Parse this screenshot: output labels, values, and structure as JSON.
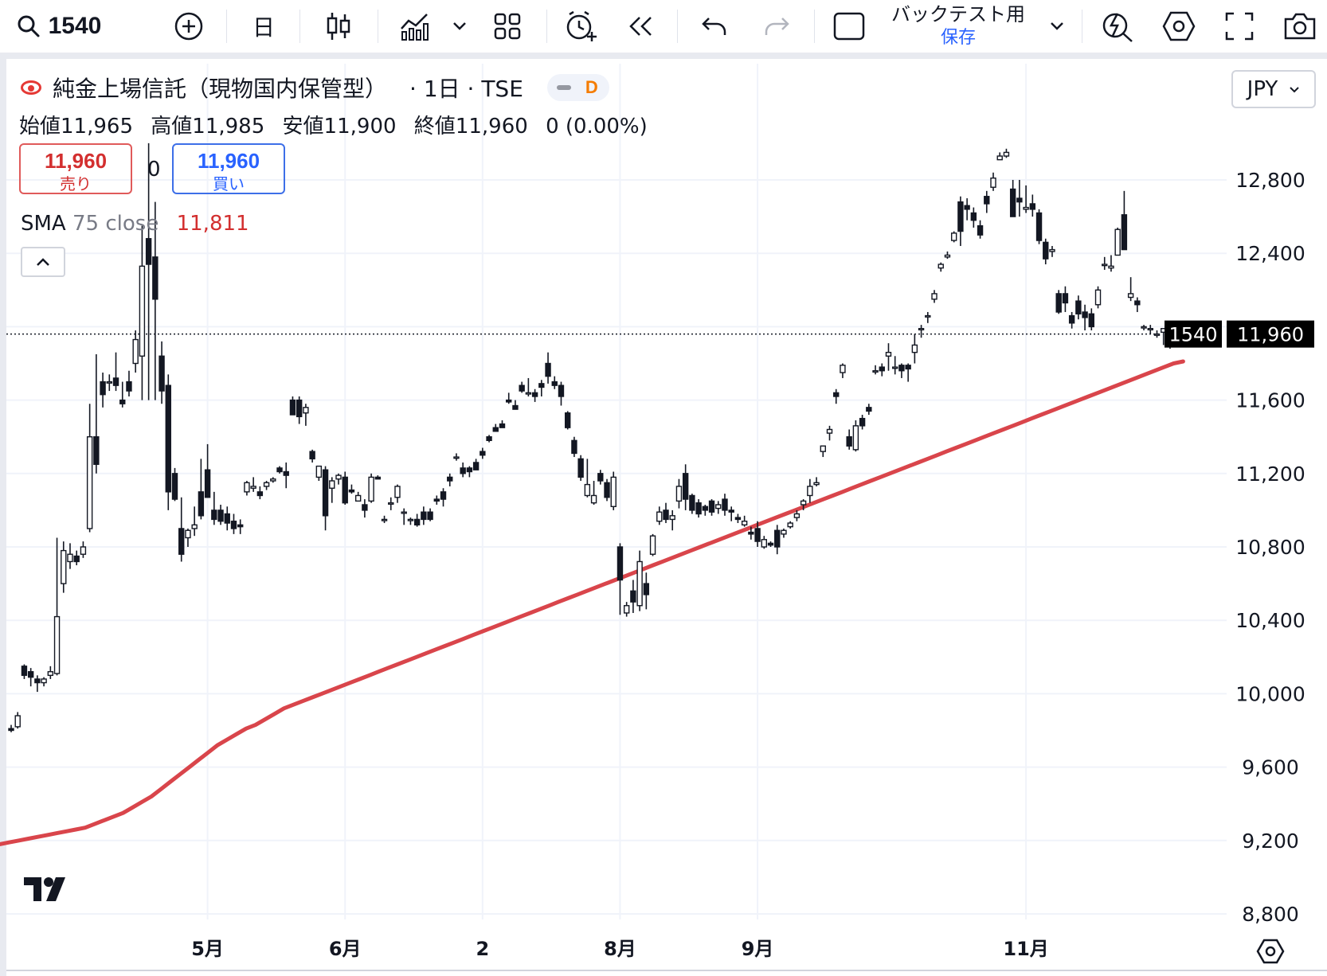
{
  "toolbar": {
    "symbol": "1540",
    "interval": "日",
    "backtest_line1": "バックテスト用",
    "backtest_line2": "保存"
  },
  "legend": {
    "title": "純金上場信託（現物国内保管型）",
    "interval_exchange": "· 1日 · TSE",
    "data_badge": "D",
    "ohlc": [
      {
        "label": "始値",
        "value": "11,965"
      },
      {
        "label": "高値",
        "value": "11,985"
      },
      {
        "label": "安値",
        "value": "11,900"
      },
      {
        "label": "終値",
        "value": "11,960"
      },
      {
        "label": "",
        "value": "0 (0.00%)"
      }
    ],
    "sell_price": "11,960",
    "sell_label": "売り",
    "spread": "0",
    "buy_price": "11,960",
    "buy_label": "買い",
    "sma_name": "SMA",
    "sma_params": "75 close",
    "sma_value": "11,811",
    "collapse_glyph": "^"
  },
  "currency": "JPY",
  "price_tags": {
    "symbol": "1540",
    "price": "11,960"
  },
  "colors": {
    "sma": "#d9454b",
    "candle": "#131722",
    "grid": "#f0f3fa",
    "sell": "#d32f2f",
    "buy": "#2962ff"
  },
  "icons": [
    "search-icon",
    "add-symbol-icon",
    "bar-style-icon",
    "indicators-icon",
    "layout-icon",
    "alert-icon",
    "replay-icon",
    "undo-icon",
    "redo-icon",
    "checkbox-icon",
    "chevron-down-icon",
    "lightning-search-icon",
    "settings-icon",
    "fullscreen-icon",
    "camera-icon",
    "chart-settings-icon"
  ],
  "chart_data": {
    "type": "candlestick",
    "symbol": "1540",
    "price_scale_ticks": [
      12800,
      12400,
      12000,
      11600,
      11200,
      10800,
      10400,
      10000,
      9600,
      9200,
      8800
    ],
    "price_scale_labels": [
      "12,800",
      "12,400",
      "",
      "11,600",
      "11,200",
      "10,800",
      "10,400",
      "10,000",
      "9,600",
      "9,200",
      "8,800"
    ],
    "ylim": [
      8800,
      13100
    ],
    "time_axis_labels": [
      {
        "label": "5月",
        "bar": 30
      },
      {
        "label": "6月",
        "bar": 51
      },
      {
        "label": "2",
        "bar": 72
      },
      {
        "label": "8月",
        "bar": 93
      },
      {
        "label": "9月",
        "bar": 114
      },
      {
        "label": "11月",
        "bar": 155
      }
    ],
    "last_price": 11960,
    "candles": [
      [
        9810,
        9830,
        9790,
        9800
      ],
      [
        9820,
        9900,
        9810,
        9880
      ],
      [
        10150,
        10160,
        10080,
        10100
      ],
      [
        10120,
        10140,
        10040,
        10090
      ],
      [
        10080,
        10100,
        10010,
        10060
      ],
      [
        10060,
        10090,
        10040,
        10080
      ],
      [
        10100,
        10150,
        10080,
        10120
      ],
      [
        10110,
        10850,
        10100,
        10420
      ],
      [
        10600,
        10830,
        10550,
        10780
      ],
      [
        10720,
        10820,
        10680,
        10760
      ],
      [
        10750,
        10780,
        10700,
        10720
      ],
      [
        10760,
        10830,
        10740,
        10800
      ],
      [
        10900,
        11580,
        10880,
        11400
      ],
      [
        11400,
        11850,
        11200,
        11250
      ],
      [
        11700,
        11750,
        11560,
        11630
      ],
      [
        11700,
        11740,
        11650,
        11700
      ],
      [
        11720,
        11860,
        11650,
        11680
      ],
      [
        11600,
        11700,
        11560,
        11580
      ],
      [
        11700,
        11760,
        11620,
        11650
      ],
      [
        11800,
        11980,
        11750,
        11930
      ],
      [
        11840,
        12550,
        11600,
        12330
      ],
      [
        12480,
        13000,
        11600,
        12340
      ],
      [
        12380,
        12680,
        11600,
        12150
      ],
      [
        11840,
        11920,
        11580,
        11650
      ],
      [
        11680,
        11740,
        11000,
        11100
      ],
      [
        11200,
        11230,
        11050,
        11060
      ],
      [
        10900,
        11070,
        10720,
        10760
      ],
      [
        10850,
        10900,
        10800,
        10890
      ],
      [
        10900,
        11020,
        10860,
        10920
      ],
      [
        11100,
        11280,
        10950,
        10970
      ],
      [
        11220,
        11360,
        11100,
        11070
      ],
      [
        11000,
        11100,
        10920,
        10950
      ],
      [
        11000,
        11030,
        10920,
        10940
      ],
      [
        10980,
        11020,
        10890,
        10930
      ],
      [
        10940,
        10980,
        10870,
        10900
      ],
      [
        10920,
        10950,
        10870,
        10910
      ],
      [
        11100,
        11160,
        11080,
        11150
      ],
      [
        11120,
        11180,
        11100,
        11130
      ],
      [
        11100,
        11130,
        11060,
        11080
      ],
      [
        11130,
        11160,
        11110,
        11150
      ],
      [
        11160,
        11180,
        11150,
        11170
      ],
      [
        11230,
        11240,
        11200,
        11210
      ],
      [
        11210,
        11260,
        11120,
        11190
      ],
      [
        11600,
        11620,
        11580,
        11520
      ],
      [
        11600,
        11620,
        11470,
        11510
      ],
      [
        11530,
        11580,
        11460,
        11560
      ],
      [
        11320,
        11330,
        11260,
        11280
      ],
      [
        11180,
        11240,
        11160,
        11240
      ],
      [
        11220,
        11240,
        10890,
        10970
      ],
      [
        11120,
        11180,
        11040,
        11160
      ],
      [
        11170,
        11200,
        11140,
        11190
      ],
      [
        11180,
        11210,
        11030,
        11040
      ],
      [
        11110,
        11140,
        11090,
        11100
      ],
      [
        11050,
        11100,
        11070,
        11080
      ],
      [
        11030,
        11060,
        10960,
        11000
      ],
      [
        11050,
        11200,
        11040,
        11180
      ],
      [
        11180,
        11190,
        11170,
        11170
      ],
      [
        10950,
        10970,
        10930,
        10950
      ],
      [
        11040,
        11070,
        11000,
        11040
      ],
      [
        11070,
        11140,
        11040,
        11130
      ],
      [
        10990,
        11010,
        10920,
        10990
      ],
      [
        10950,
        10960,
        10920,
        10950
      ],
      [
        10950,
        10980,
        10910,
        10920
      ],
      [
        10990,
        11020,
        10920,
        10950
      ],
      [
        10990,
        11010,
        10940,
        10950
      ],
      [
        11060,
        11080,
        11030,
        11050
      ],
      [
        11100,
        11120,
        11020,
        11060
      ],
      [
        11180,
        11200,
        11130,
        11160
      ],
      [
        11290,
        11310,
        11270,
        11290
      ],
      [
        11230,
        11260,
        11180,
        11200
      ],
      [
        11230,
        11240,
        11180,
        11210
      ],
      [
        11260,
        11280,
        11220,
        11220
      ],
      [
        11320,
        11340,
        11280,
        11300
      ],
      [
        11400,
        11410,
        11370,
        11380
      ],
      [
        11450,
        11470,
        11430,
        11430
      ],
      [
        11470,
        11490,
        11450,
        11450
      ],
      [
        11600,
        11640,
        11580,
        11590
      ],
      [
        11570,
        11600,
        11550,
        11550
      ],
      [
        11680,
        11700,
        11640,
        11650
      ],
      [
        11640,
        11720,
        11620,
        11640
      ],
      [
        11640,
        11660,
        11590,
        11620
      ],
      [
        11690,
        11710,
        11620,
        11670
      ],
      [
        11800,
        11860,
        11690,
        11730
      ],
      [
        11700,
        11730,
        11660,
        11680
      ],
      [
        11680,
        11700,
        11570,
        11620
      ],
      [
        11530,
        11540,
        11440,
        11450
      ],
      [
        11380,
        11400,
        11290,
        11310
      ],
      [
        11280,
        11300,
        11160,
        11180
      ],
      [
        11080,
        11280,
        11070,
        11140
      ],
      [
        11040,
        11160,
        11030,
        11080
      ],
      [
        11200,
        11220,
        11140,
        11160
      ],
      [
        11150,
        11170,
        11050,
        11070
      ],
      [
        11020,
        11210,
        11000,
        11180
      ],
      [
        10800,
        10820,
        10430,
        10620
      ],
      [
        10440,
        10500,
        10420,
        10480
      ],
      [
        10560,
        10620,
        10440,
        10500
      ],
      [
        10480,
        10780,
        10450,
        10720
      ],
      [
        10600,
        10660,
        10460,
        10540
      ],
      [
        10760,
        10870,
        10750,
        10860
      ],
      [
        10940,
        11020,
        10920,
        10990
      ],
      [
        11000,
        11040,
        10930,
        10950
      ],
      [
        10950,
        11000,
        10890,
        10970
      ],
      [
        11050,
        11170,
        11010,
        11130
      ],
      [
        11200,
        11250,
        11000,
        11060
      ],
      [
        11080,
        11090,
        10980,
        11000
      ],
      [
        11040,
        11060,
        10960,
        10980
      ],
      [
        11020,
        11030,
        10970,
        11000
      ],
      [
        11050,
        11060,
        10970,
        10990
      ],
      [
        11010,
        11050,
        10980,
        11030
      ],
      [
        11060,
        11090,
        10970,
        11000
      ],
      [
        11000,
        11020,
        10940,
        10990
      ],
      [
        10960,
        10980,
        10930,
        10950
      ],
      [
        10920,
        10970,
        10910,
        10940
      ],
      [
        10880,
        10910,
        10840,
        10870
      ],
      [
        10900,
        10940,
        10800,
        10830
      ],
      [
        10800,
        10860,
        10790,
        10840
      ],
      [
        10820,
        10830,
        10800,
        10810
      ],
      [
        10890,
        10920,
        10760,
        10800
      ],
      [
        10870,
        10900,
        10850,
        10890
      ],
      [
        10910,
        10940,
        10900,
        10930
      ],
      [
        10960,
        11000,
        10940,
        10980
      ],
      [
        11030,
        11060,
        11000,
        11050
      ],
      [
        11080,
        11170,
        11040,
        11130
      ],
      [
        11140,
        11180,
        11130,
        11150
      ],
      [
        11320,
        11350,
        11290,
        11350
      ],
      [
        11420,
        11460,
        11380,
        11440
      ],
      [
        11640,
        11660,
        11580,
        11620
      ],
      [
        11750,
        11800,
        11720,
        11790
      ],
      [
        11400,
        11440,
        11330,
        11350
      ],
      [
        11330,
        11490,
        11320,
        11460
      ],
      [
        11500,
        11520,
        11440,
        11460
      ],
      [
        11560,
        11580,
        11520,
        11540
      ],
      [
        11760,
        11790,
        11740,
        11760
      ],
      [
        11780,
        11800,
        11730,
        11760
      ],
      [
        11840,
        11910,
        11760,
        11860
      ],
      [
        11780,
        11840,
        11740,
        11780
      ],
      [
        11790,
        11800,
        11720,
        11760
      ],
      [
        11790,
        11800,
        11700,
        11770
      ],
      [
        11860,
        11960,
        11800,
        11900
      ],
      [
        11990,
        12010,
        11940,
        11990
      ],
      [
        12060,
        12080,
        12020,
        12060
      ],
      [
        12150,
        12200,
        12130,
        12180
      ],
      [
        12320,
        12350,
        12300,
        12340
      ],
      [
        12380,
        12410,
        12370,
        12390
      ],
      [
        12470,
        12520,
        12460,
        12510
      ],
      [
        12680,
        12710,
        12440,
        12520
      ],
      [
        12660,
        12700,
        12580,
        12640
      ],
      [
        12620,
        12650,
        12540,
        12580
      ],
      [
        12550,
        12580,
        12480,
        12500
      ],
      [
        12710,
        12740,
        12620,
        12670
      ],
      [
        12760,
        12840,
        12740,
        12810
      ],
      [
        12910,
        12950,
        12920,
        12930
      ],
      [
        12930,
        12970,
        12920,
        12950
      ],
      [
        12750,
        12800,
        12600,
        12600
      ],
      [
        12700,
        12800,
        12600,
        12680
      ],
      [
        12640,
        12770,
        12620,
        12650
      ],
      [
        12670,
        12720,
        12600,
        12640
      ],
      [
        12620,
        12640,
        12450,
        12470
      ],
      [
        12460,
        12480,
        12340,
        12370
      ],
      [
        12410,
        12440,
        12380,
        12420
      ],
      [
        12180,
        12200,
        12070,
        12080
      ],
      [
        12180,
        12220,
        12080,
        12130
      ],
      [
        12060,
        12080,
        11990,
        12020
      ],
      [
        12140,
        12170,
        12040,
        12070
      ],
      [
        12080,
        12120,
        11980,
        12050
      ],
      [
        12070,
        12100,
        11980,
        12000
      ],
      [
        12120,
        12220,
        12100,
        12200
      ],
      [
        12340,
        12380,
        12310,
        12340
      ],
      [
        12320,
        12390,
        12300,
        12330
      ],
      [
        12390,
        12540,
        12390,
        12530
      ],
      [
        12610,
        12740,
        12420,
        12420
      ],
      [
        12160,
        12270,
        12140,
        12180
      ],
      [
        12140,
        12160,
        12080,
        12120
      ],
      [
        12000,
        12010,
        11980,
        12000
      ],
      [
        11990,
        12010,
        11960,
        11990
      ],
      [
        11960,
        11980,
        11940,
        11960
      ],
      [
        11970,
        11990,
        11900,
        11990
      ],
      [
        11960,
        11990,
        11880,
        11940
      ],
      [
        11950,
        11970,
        11900,
        11960
      ],
      [
        11965,
        11985,
        11900,
        11960
      ]
    ],
    "sma75": [
      9180,
      9190,
      9200,
      9210,
      9220,
      9230,
      9240,
      9250,
      9260,
      9270,
      9290,
      9310,
      9330,
      9350,
      9380,
      9410,
      9440,
      9480,
      9520,
      9560,
      9600,
      9640,
      9680,
      9720,
      9750,
      9780,
      9810,
      9830,
      9860,
      9890,
      9920,
      9940,
      9960,
      9980,
      10000,
      10020,
      10040,
      10060,
      10080,
      10100,
      10120,
      10140,
      10160,
      10180,
      10200,
      10220,
      10240,
      10260,
      10280,
      10300,
      10320,
      10340,
      10360,
      10380,
      10400,
      10420,
      10440,
      10460,
      10480,
      10500,
      10520,
      10540,
      10560,
      10580,
      10600,
      10620,
      10640,
      10660,
      10680,
      10700,
      10720,
      10740,
      10760,
      10780,
      10800,
      10820,
      10840,
      10860,
      10880,
      10900,
      10920,
      10940,
      10960,
      10980,
      11000,
      11020,
      11040,
      11060,
      11080,
      11100,
      11120,
      11140,
      11160,
      11180,
      11200,
      11220,
      11240,
      11260,
      11280,
      11300,
      11320,
      11340,
      11360,
      11380,
      11400,
      11420,
      11440,
      11460,
      11480,
      11500,
      11520,
      11540,
      11560,
      11580,
      11600,
      11620,
      11640,
      11660,
      11680,
      11700,
      11720,
      11740,
      11760,
      11780,
      11800,
      11811
    ]
  }
}
